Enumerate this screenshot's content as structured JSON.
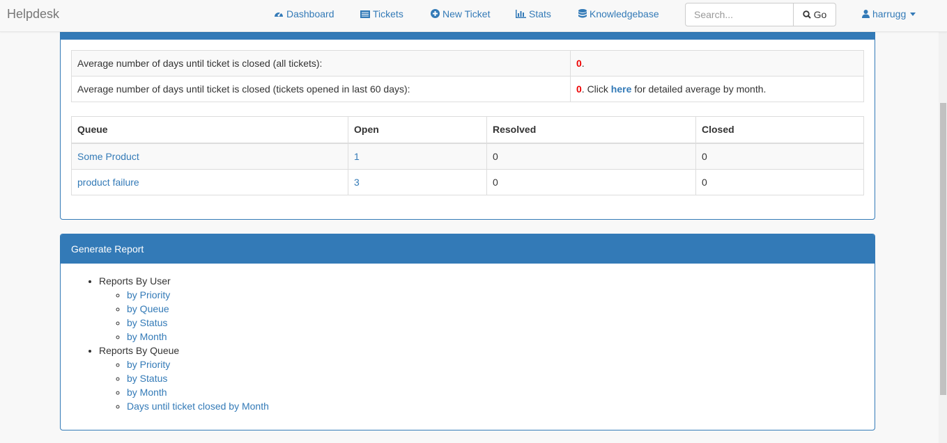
{
  "navbar": {
    "brand": "Helpdesk",
    "items": [
      {
        "label": "Dashboard",
        "icon": "dashboard-icon"
      },
      {
        "label": "Tickets",
        "icon": "tickets-icon"
      },
      {
        "label": "New Ticket",
        "icon": "plus-circle-icon"
      },
      {
        "label": "Stats",
        "icon": "bar-chart-icon"
      },
      {
        "label": "Knowledgebase",
        "icon": "database-icon"
      }
    ],
    "search_placeholder": "Search...",
    "go_label": "Go",
    "user": "harrugg"
  },
  "stats": {
    "row1_label": "Average number of days until ticket is closed (all tickets):",
    "row1_value": "0",
    "row1_suffix": ".",
    "row2_label": "Average number of days until ticket is closed (tickets opened in last 60 days):",
    "row2_value": "0",
    "row2_mid": ". Click ",
    "row2_link": "here",
    "row2_suffix": " for detailed average by month."
  },
  "queue_table": {
    "headers": [
      "Queue",
      "Open",
      "Resolved",
      "Closed"
    ],
    "rows": [
      {
        "queue": "Some Product",
        "open": "1",
        "resolved": "0",
        "closed": "0"
      },
      {
        "queue": "product failure",
        "open": "3",
        "resolved": "0",
        "closed": "0"
      }
    ]
  },
  "report": {
    "heading": "Generate Report",
    "by_user": {
      "label": "Reports By User",
      "links": [
        "by Priority",
        "by Queue",
        "by Status",
        "by Month"
      ]
    },
    "by_queue": {
      "label": "Reports By Queue",
      "links": [
        "by Priority",
        "by Status",
        "by Month",
        "Days until ticket closed by Month"
      ]
    }
  },
  "colors": {
    "primary": "#337ab7",
    "accent_red": "#e00"
  }
}
